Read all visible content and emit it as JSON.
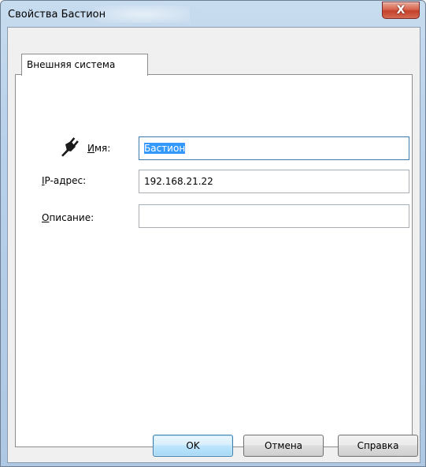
{
  "window": {
    "title": "Свойства Бастион",
    "close_glyph": "X"
  },
  "tabs": [
    {
      "label": "Внешняя система",
      "active": true
    }
  ],
  "form": {
    "icon": "plug-icon",
    "name": {
      "label_accel": "И",
      "label_rest": "мя:",
      "value": "Бастион",
      "selected": true
    },
    "ip": {
      "label_accel": "I",
      "label_rest": "P-адрес:",
      "value": "192.168.21.22"
    },
    "description": {
      "label_accel": "О",
      "label_rest": "писание:",
      "value": ""
    }
  },
  "buttons": {
    "ok": "OK",
    "cancel": "Отмена",
    "help": "Справка"
  },
  "colors": {
    "selection": "#3399ff",
    "focus_border": "#3d7bad",
    "close_button": "#c4402a"
  }
}
